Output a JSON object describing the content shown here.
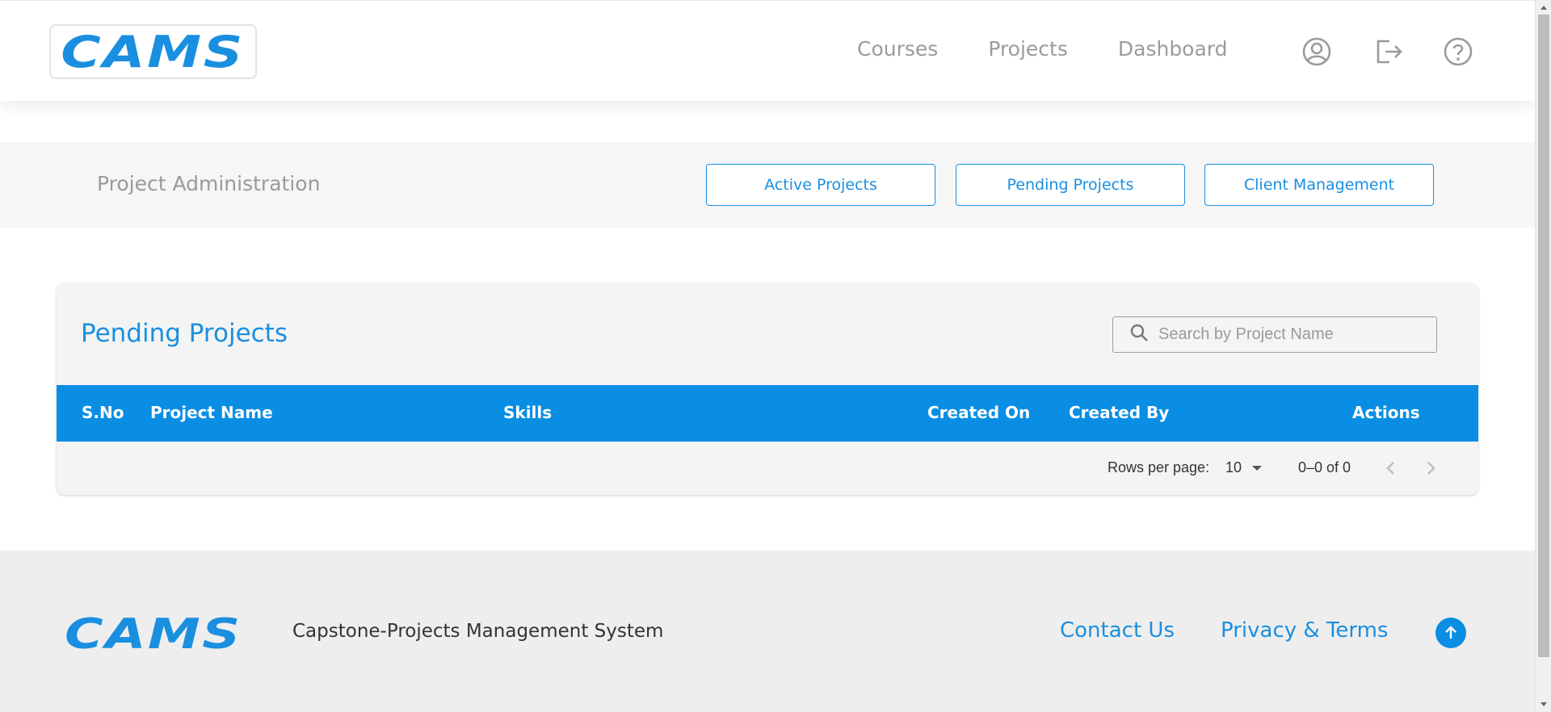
{
  "header": {
    "logo": "CAMS",
    "nav": [
      "Courses",
      "Projects",
      "Dashboard"
    ],
    "icons": [
      "account-circle-icon",
      "logout-icon",
      "help-icon"
    ]
  },
  "admin": {
    "title": "Project Administration",
    "buttons": [
      "Active Projects",
      "Pending Projects",
      "Client Management"
    ]
  },
  "card": {
    "title": "Pending Projects",
    "search_placeholder": "Search by Project Name",
    "columns": [
      "S.No",
      "Project Name",
      "Skills",
      "Created On",
      "Created By",
      "Actions"
    ],
    "rows": [],
    "pagination": {
      "rows_per_page_label": "Rows per page:",
      "rows_per_page": "10",
      "range": "0–0 of 0"
    }
  },
  "footer": {
    "logo": "CAMS",
    "tagline": "Capstone-Projects Management System",
    "links": [
      "Contact Us",
      "Privacy & Terms"
    ]
  },
  "colors": {
    "accent": "#0a8ee4",
    "muted": "#9b9b9b"
  }
}
